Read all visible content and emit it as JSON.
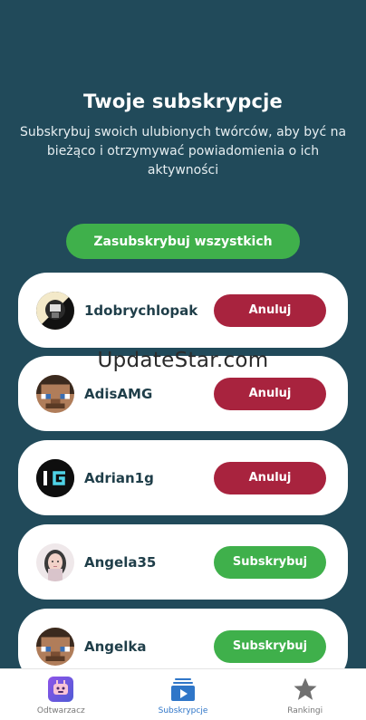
{
  "header": {
    "title": "Twoje subskrypcje",
    "subtitle": "Subskrybuj swoich ulubionych twórców, aby być na bieżąco i otrzymywać powiadomienia o ich aktywności"
  },
  "subscribe_all_label": "Zasubskrybuj wszystkich",
  "creators": [
    {
      "name": "1dobrychlopak",
      "button": "Anuluj",
      "state": "cancel"
    },
    {
      "name": "AdisAMG",
      "button": "Anuluj",
      "state": "cancel"
    },
    {
      "name": "Adrian1g",
      "button": "Anuluj",
      "state": "cancel"
    },
    {
      "name": "Angela35",
      "button": "Subskrybuj",
      "state": "subscribe"
    },
    {
      "name": "Angelka",
      "button": "Subskrybuj",
      "state": "subscribe"
    }
  ],
  "watermark": "UpdateStar.com",
  "tabbar": {
    "tabs": [
      {
        "label": "Odtwarzacz",
        "icon": "player-icon"
      },
      {
        "label": "Subskrypcje",
        "icon": "subscriptions-icon",
        "active": true
      },
      {
        "label": "Rankingi",
        "icon": "star-icon"
      }
    ]
  },
  "colors": {
    "background": "#214a5a",
    "green": "#3fb04b",
    "red": "#a8233e",
    "active_tab": "#2f76c8"
  }
}
